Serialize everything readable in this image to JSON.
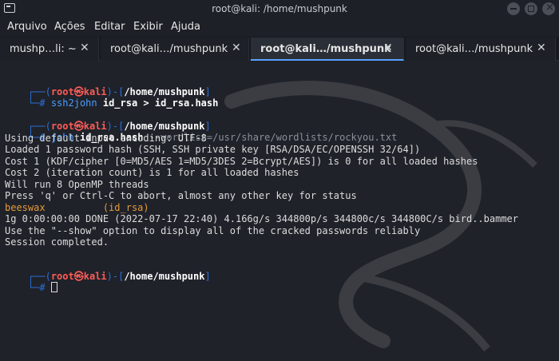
{
  "window": {
    "title": "root@kali: /home/mushpunk"
  },
  "menu": [
    "Arquivo",
    "Ações",
    "Editar",
    "Exibir",
    "Ajuda"
  ],
  "tabs": [
    {
      "label": "mushp…li: ~",
      "close": "✕"
    },
    {
      "label": "root@kali…/mushpunk",
      "close": "✕"
    },
    {
      "label": "root@kali…/mushpunk",
      "close": "✕"
    },
    {
      "label": "root@kali…/mushpunk",
      "close": "✕"
    }
  ],
  "tab_add": "+",
  "prompt": {
    "bracket_open": "┌──(",
    "user": "root",
    "at": "㉿",
    "host": "kali",
    "bracket_close": ")-[",
    "path": "/home/mushpunk",
    "path_close": "]",
    "line2": "└─",
    "hash": "#"
  },
  "commands": {
    "cmd1": "ssh2john",
    "cmd1_args": "id_rsa > id_rsa.hash",
    "cmd2": "john",
    "cmd2_args": "id_rsa.hash",
    "cmd2_opt": "--wordlist=/usr/share/wordlists/rockyou.txt"
  },
  "output": [
    "Using default input encoding: UTF-8",
    "Loaded 1 password hash (SSH, SSH private key [RSA/DSA/EC/OPENSSH 32/64])",
    "Cost 1 (KDF/cipher [0=MD5/AES 1=MD5/3DES 2=Bcrypt/AES]) is 0 for all loaded hashes",
    "Cost 2 (iteration count) is 1 for all loaded hashes",
    "Will run 8 OpenMP threads",
    "Press 'q' or Ctrl-C to abort, almost any other key for status",
    "beeswax          (id_rsa)",
    "1g 0:00:00:00 DONE (2022-07-17 22:40) 4.166g/s 344800p/s 344800c/s 344800C/s bird..bammer",
    "Use the \"--show\" option to display all of the cracked passwords reliably",
    "Session completed."
  ],
  "colors": {
    "prompt_frame": "#2b6fd9",
    "prompt_user": "#ff5c57",
    "command": "#4a9eff",
    "password": "#e69a3a"
  }
}
